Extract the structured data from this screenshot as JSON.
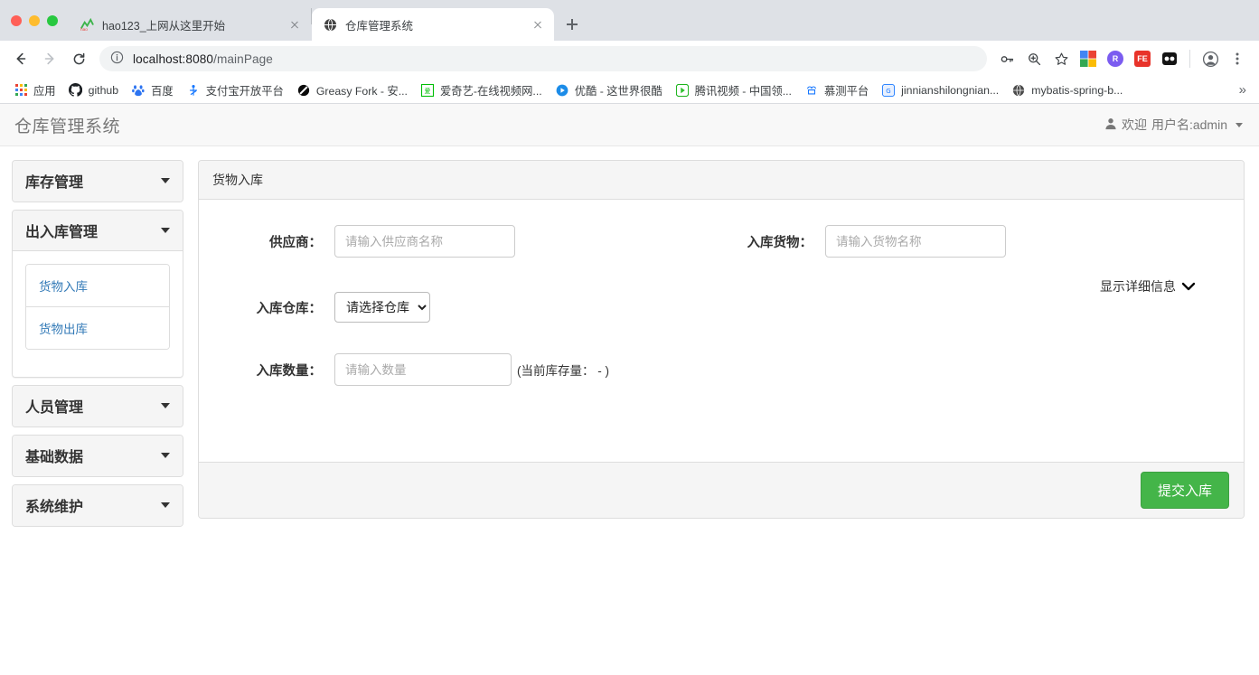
{
  "browser": {
    "tabs": [
      {
        "title": "hao123_上网从这里开始",
        "icon": "hao123-icon",
        "active": false
      },
      {
        "title": "仓库管理系统",
        "icon": "globe-icon",
        "active": true
      }
    ],
    "new_tab_label": "+",
    "omnibox": {
      "url_host": "localhost:8080",
      "url_path": "/mainPage",
      "info_icon": "info-icon"
    },
    "nav": {
      "back": "back-arrow-icon",
      "forward": "forward-arrow-icon",
      "reload": "reload-icon"
    },
    "toolbar_icons": [
      "key-icon",
      "zoom-icon",
      "star-icon",
      "google-photos-extension",
      "r-extension",
      "fe-extension",
      "dark-reader-extension",
      "profile-avatar-icon",
      "chrome-menu-icon"
    ],
    "bookmarks": [
      {
        "label": "应用",
        "icon": "apps-grid-icon"
      },
      {
        "label": "github",
        "icon": "github-icon"
      },
      {
        "label": "百度",
        "icon": "baidu-icon"
      },
      {
        "label": "支付宝开放平台",
        "icon": "alipay-icon"
      },
      {
        "label": "Greasy Fork - 安...",
        "icon": "greasyfork-icon"
      },
      {
        "label": "爱奇艺-在线视频网...",
        "icon": "iqiyi-icon"
      },
      {
        "label": "优酷 - 这世界很酷",
        "icon": "youku-icon"
      },
      {
        "label": "腾讯视频 - 中国领...",
        "icon": "tencent-video-icon"
      },
      {
        "label": "慕测平台",
        "icon": "muce-icon"
      },
      {
        "label": "jinnianshilongnian...",
        "icon": "generic-site-icon"
      },
      {
        "label": "mybatis-spring-b...",
        "icon": "globe-icon"
      }
    ],
    "bookmarks_overflow": "»"
  },
  "app": {
    "header": {
      "title": "仓库管理系统",
      "user_icon": "person-icon",
      "welcome": "欢迎",
      "username_label": "用户名:admin"
    },
    "sidebar": {
      "groups": [
        {
          "title": "库存管理",
          "open": false,
          "items": []
        },
        {
          "title": "出入库管理",
          "open": true,
          "items": [
            {
              "label": "货物入库"
            },
            {
              "label": "货物出库"
            }
          ]
        },
        {
          "title": "人员管理",
          "open": false,
          "items": []
        },
        {
          "title": "基础数据",
          "open": false,
          "items": []
        },
        {
          "title": "系统维护",
          "open": false,
          "items": []
        }
      ]
    },
    "panel": {
      "title": "货物入库",
      "fields": {
        "supplier": {
          "label": "供应商：",
          "placeholder": "请输入供应商名称",
          "value": ""
        },
        "goods": {
          "label": "入库货物：",
          "placeholder": "请输入货物名称",
          "value": ""
        },
        "warehouse": {
          "label": "入库仓库：",
          "selected": "请选择仓库",
          "options": [
            "请选择仓库"
          ]
        },
        "quantity": {
          "label": "入库数量：",
          "placeholder": "请输入数量",
          "value": "",
          "stock_hint": "(当前库存量： - )"
        }
      },
      "detail_toggle": {
        "label": "显示详细信息",
        "icon": "chevron-down-icon"
      },
      "submit_label": "提交入库",
      "submit_color": "#44b549"
    }
  }
}
